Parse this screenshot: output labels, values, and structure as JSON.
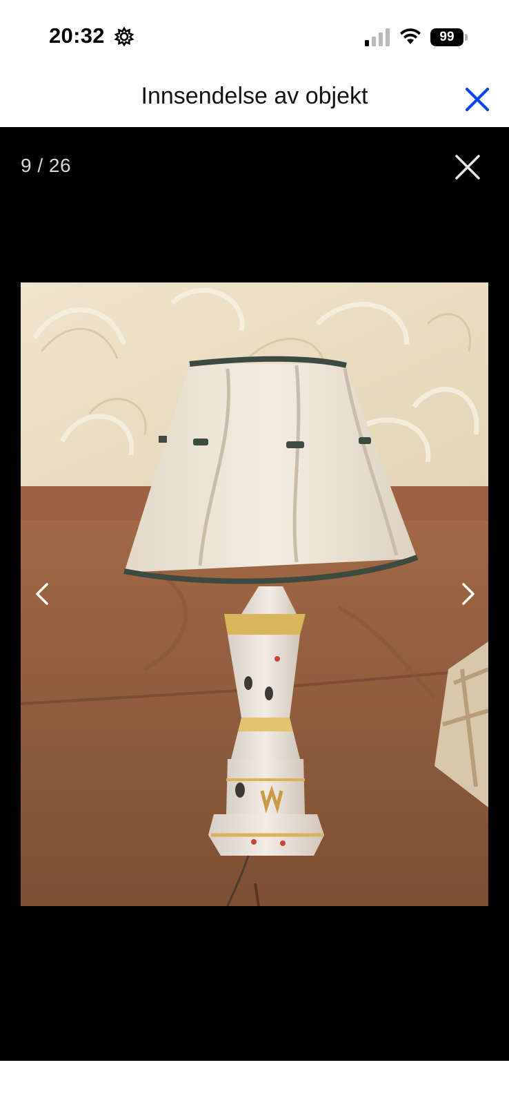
{
  "status_bar": {
    "time": "20:32",
    "battery_level": "99",
    "icons": [
      "settings-icon",
      "cellular-signal-icon",
      "wifi-icon",
      "battery-icon"
    ]
  },
  "header": {
    "title": "Innsendelse av objekt",
    "close_icon": "close-icon",
    "accent_color": "#0a47e0"
  },
  "viewer": {
    "counter": "9 / 26",
    "close_icon": "close-icon",
    "prev_icon": "chevron-left-icon",
    "next_icon": "chevron-right-icon",
    "photo_alt": "Table lamp with pleated cream shade on hand-painted porcelain base, standing on brown sofa"
  }
}
